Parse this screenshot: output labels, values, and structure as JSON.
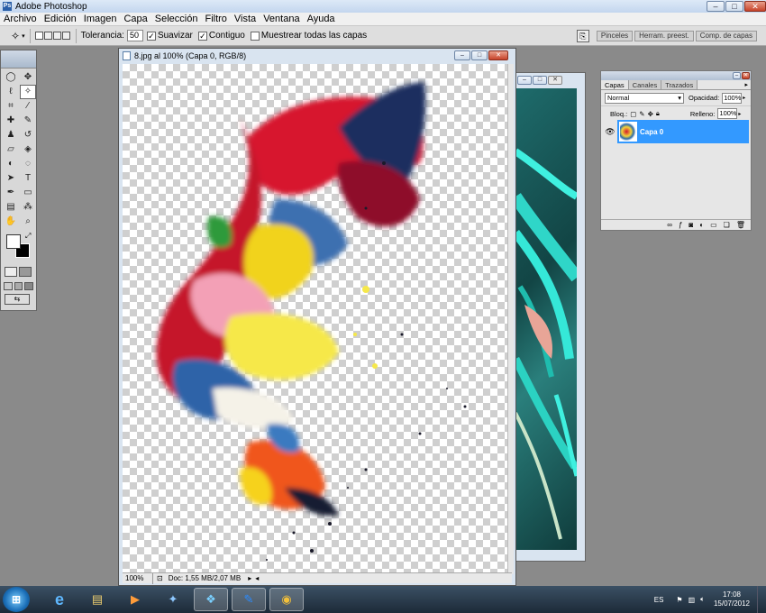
{
  "window": {
    "title": "Adobe Photoshop",
    "minimize": "–",
    "maximize": "□",
    "close": "✕"
  },
  "menu": [
    "Archivo",
    "Edición",
    "Imagen",
    "Capa",
    "Selección",
    "Filtro",
    "Vista",
    "Ventana",
    "Ayuda"
  ],
  "options": {
    "tool_icon": "magic-wand-icon",
    "tolerance_label": "Tolerancia:",
    "tolerance_value": "50",
    "antialias_label": "Suavizar",
    "antialias_checked": true,
    "contiguous_label": "Contiguo",
    "contiguous_checked": true,
    "sample_all_label": "Muestrear todas las capas",
    "sample_all_checked": false,
    "panel_tabs": [
      "Pinceles",
      "Herram. preest.",
      "Comp. de capas"
    ]
  },
  "document": {
    "title": "8.jpg al 100% (Capa 0, RGB/8)",
    "zoom": "100%",
    "doc_size": "Doc: 1,55 MB/2,07 MB"
  },
  "layers_panel": {
    "tabs": [
      "Capas",
      "Canales",
      "Trazados"
    ],
    "active_tab": "Capas",
    "blend_mode": "Normal",
    "opacity_label": "Opacidad:",
    "opacity_value": "100%",
    "lock_label": "Bloq.:",
    "fill_label": "Relleno:",
    "fill_value": "100%",
    "layers": [
      {
        "name": "Capa 0",
        "selected": true,
        "visible": true
      }
    ]
  },
  "taskbar": {
    "language": "ES",
    "time": "17:08",
    "date": "15/07/2012",
    "apps": [
      {
        "name": "internet-explorer",
        "glyph": "e"
      },
      {
        "name": "file-explorer",
        "glyph": "▤"
      },
      {
        "name": "media-player",
        "glyph": "▶"
      },
      {
        "name": "app-4",
        "glyph": "✦"
      },
      {
        "name": "app-5",
        "glyph": "❖"
      },
      {
        "name": "photoshop",
        "glyph": "✎"
      },
      {
        "name": "chrome",
        "glyph": "◉"
      }
    ]
  },
  "colors": {
    "accent": "#3399ff",
    "taskbar": "#2a3a4a"
  }
}
